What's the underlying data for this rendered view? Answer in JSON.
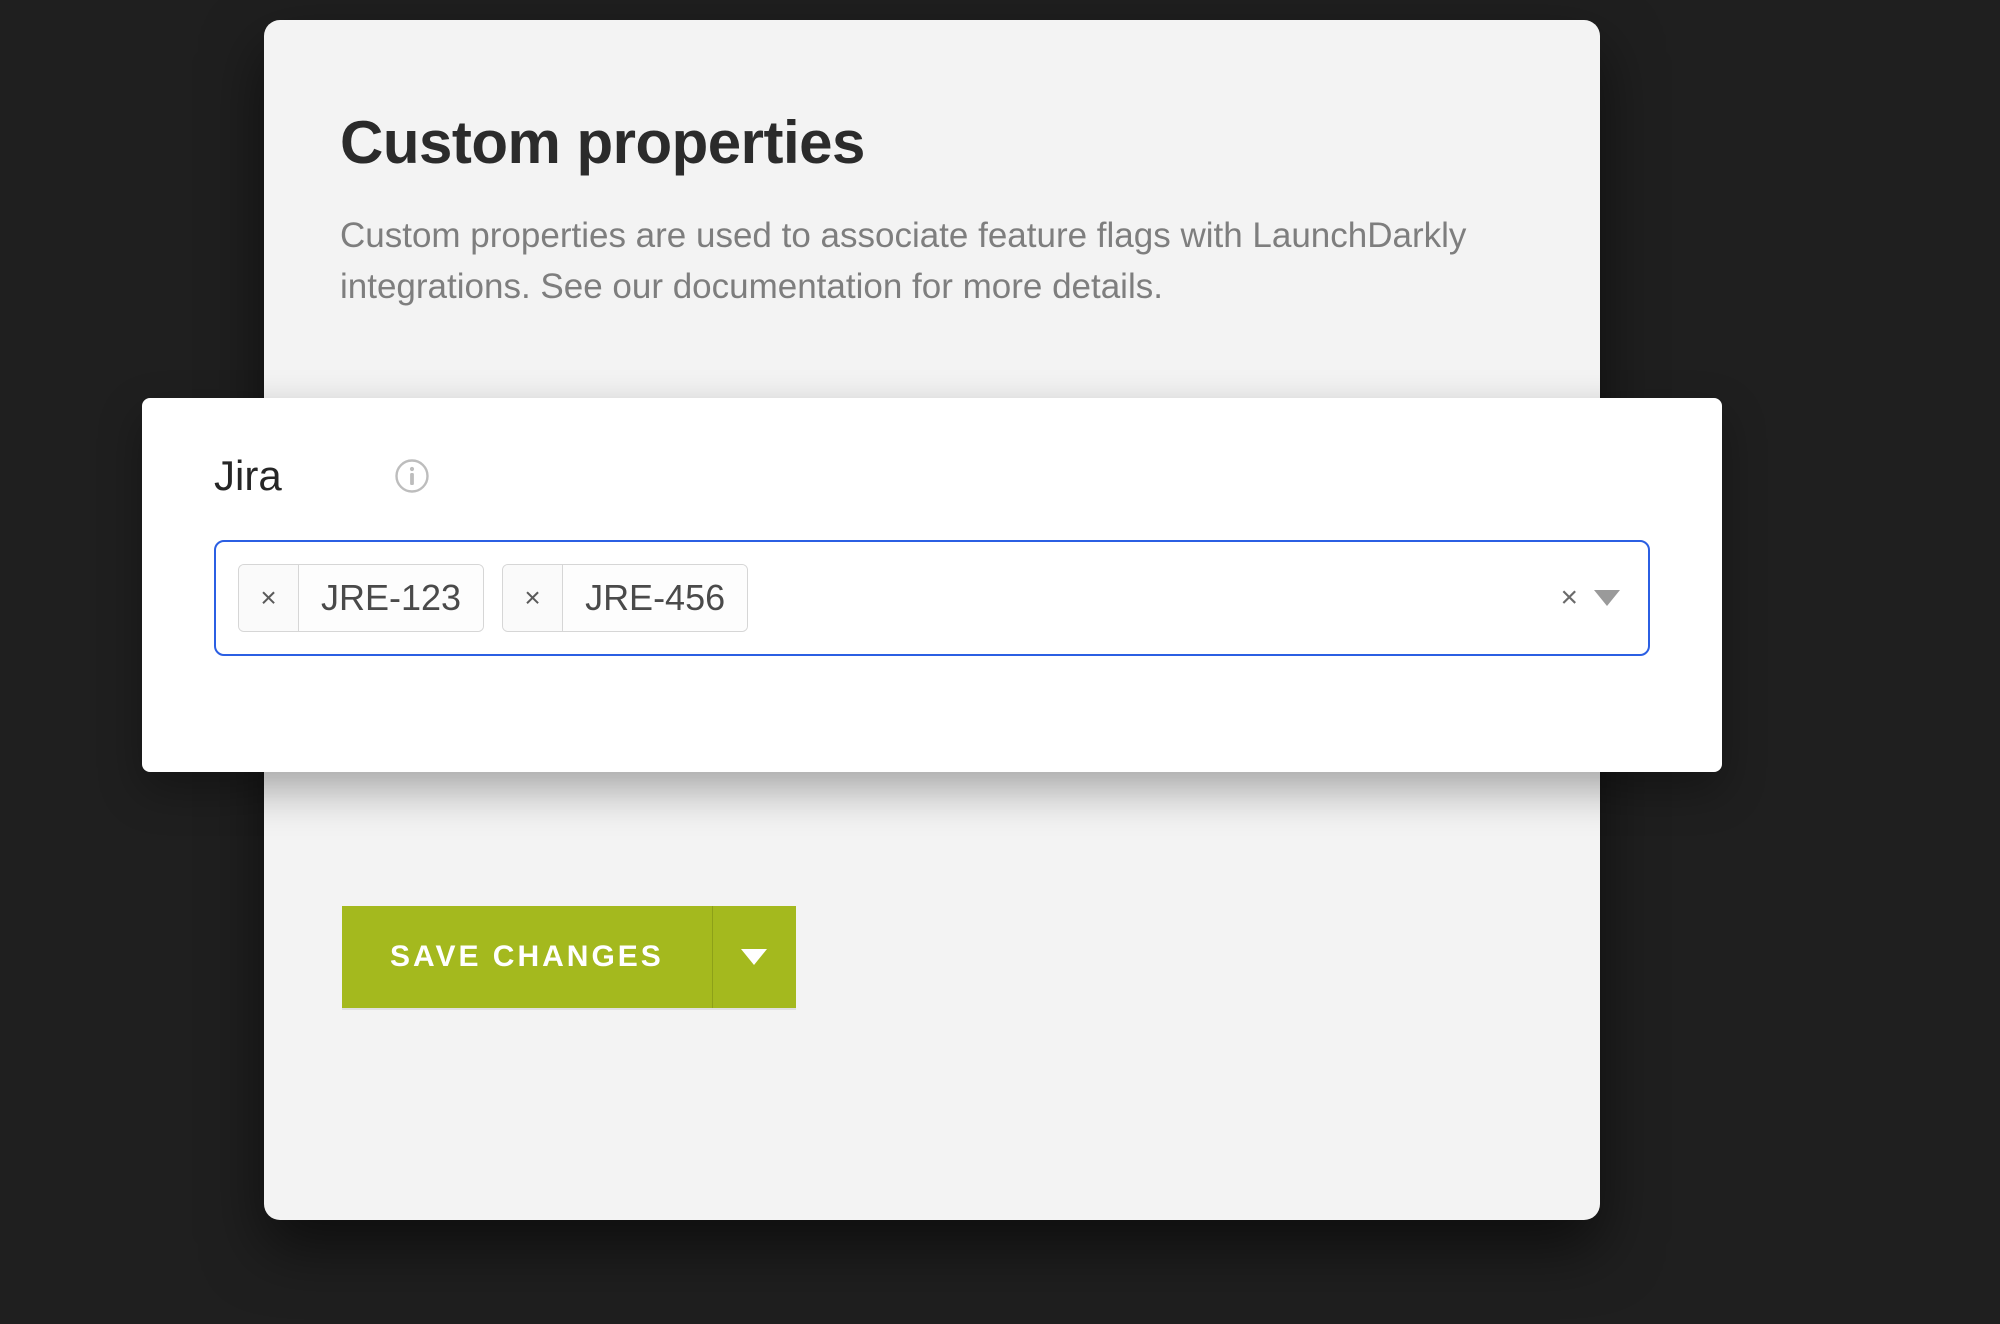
{
  "panel": {
    "heading": "Custom properties",
    "description": "Custom properties are used to associate feature flags with LaunchDarkly integrations. See our documentation for more details."
  },
  "field": {
    "label": "Jira",
    "tags": [
      "JRE-123",
      "JRE-456"
    ]
  },
  "actions": {
    "save_label": "SAVE CHANGES"
  },
  "colors": {
    "focus_border": "#2b5fe3",
    "primary_button": "#a4b91e"
  }
}
